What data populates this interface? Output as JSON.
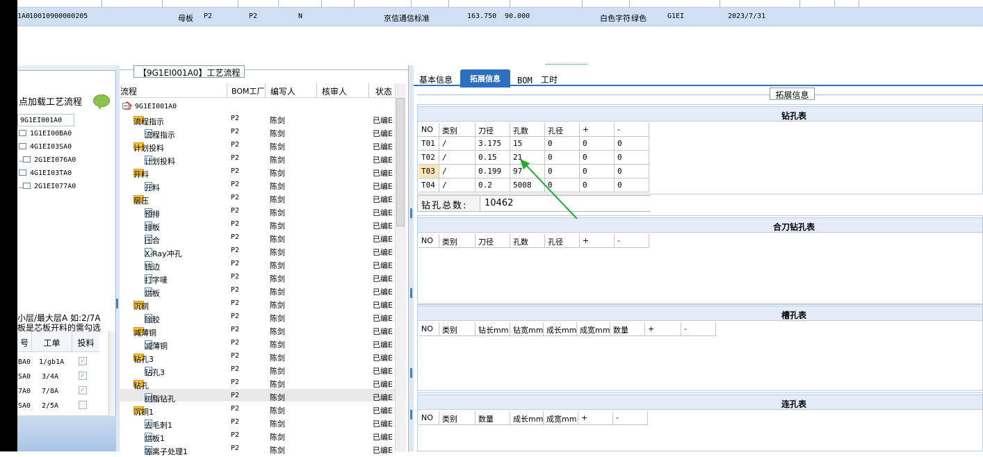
{
  "top_row": {
    "cells": [
      "1A0",
      "10010900000205",
      "母板",
      "P2",
      "P2",
      "N",
      "京信通信标准",
      "163.750",
      "90.000",
      "白色字符",
      "绿色",
      "G1EI",
      "2023/7/31"
    ]
  },
  "left_panel": {
    "load_label": "点加载工艺流程",
    "tree_root": "9G1EI001A0",
    "tree_items": [
      "1G1EI00BA0",
      "4G1EI03SA0",
      "2G1EI076A0",
      "4G1EI03TA0",
      "2G1EI077A0"
    ],
    "hint_line1": "小层/最大层A 如:2/7A",
    "hint_line2": "板是芯板开料的需勾选",
    "wo_headers": [
      "号",
      "工单",
      "投料"
    ],
    "wo_rows": [
      {
        "id": "BA0",
        "order": "1/gb1A",
        "checked": true
      },
      {
        "id": "SA0",
        "order": "3/4A",
        "checked": true
      },
      {
        "id": "7A0",
        "order": "7/8A",
        "checked": true
      },
      {
        "id": "SA0",
        "order": "2/5A",
        "checked": false
      }
    ]
  },
  "process_panel": {
    "title": "【9G1EI001A0】工艺流程",
    "headers": [
      "流程",
      "BOM工厂",
      "编写人",
      "核审人",
      "状态"
    ],
    "root": "9G1EI001A0",
    "rows": [
      {
        "name": "流程指示",
        "kind": "folder",
        "factory": "P2",
        "author": "陈剑",
        "status": "已编E"
      },
      {
        "name": "流程指示",
        "kind": "doc",
        "factory": "P2",
        "author": "陈剑",
        "status": "已编E"
      },
      {
        "name": "计划投料",
        "kind": "folder",
        "factory": "P2",
        "author": "陈剑",
        "status": "已编E"
      },
      {
        "name": "计划投料",
        "kind": "doc",
        "factory": "P2",
        "author": "陈剑",
        "status": "已编E"
      },
      {
        "name": "开料",
        "kind": "folder",
        "factory": "P2",
        "author": "陈剑",
        "status": "已编E"
      },
      {
        "name": "开料",
        "kind": "doc",
        "factory": "P2",
        "author": "陈剑",
        "status": "已编E"
      },
      {
        "name": "层压",
        "kind": "folder",
        "factory": "P2",
        "author": "陈剑",
        "status": "已编E"
      },
      {
        "name": "预排",
        "kind": "doc",
        "factory": "P2",
        "author": "陈剑",
        "status": "已编E"
      },
      {
        "name": "排板",
        "kind": "doc",
        "factory": "P2",
        "author": "陈剑",
        "status": "已编E"
      },
      {
        "name": "压合",
        "kind": "doc",
        "factory": "P2",
        "author": "陈剑",
        "status": "已编E"
      },
      {
        "name": "X-Ray冲孔",
        "kind": "doc",
        "factory": "P2",
        "author": "陈剑",
        "status": "已编E"
      },
      {
        "name": "铣边",
        "kind": "doc",
        "factory": "P2",
        "author": "陈剑",
        "status": "已编E"
      },
      {
        "name": "打字唛",
        "kind": "doc",
        "factory": "P2",
        "author": "陈剑",
        "status": "已编E"
      },
      {
        "name": "烘板",
        "kind": "doc",
        "factory": "P2",
        "author": "陈剑",
        "status": "已编E"
      },
      {
        "name": "沉铜",
        "kind": "folder",
        "factory": "P2",
        "author": "陈剑",
        "status": "已编E"
      },
      {
        "name": "除胶",
        "kind": "doc",
        "factory": "P2",
        "author": "陈剑",
        "status": "已编E"
      },
      {
        "name": "减薄铜",
        "kind": "folder",
        "factory": "P2",
        "author": "陈剑",
        "status": "已编E"
      },
      {
        "name": "减薄铜",
        "kind": "doc",
        "factory": "P2",
        "author": "陈剑",
        "status": "已编E"
      },
      {
        "name": "钻孔3",
        "kind": "folder",
        "factory": "P2",
        "author": "陈剑",
        "status": "已编E"
      },
      {
        "name": "钻孔3",
        "kind": "doc",
        "factory": "P2",
        "author": "陈剑",
        "status": "已编E"
      },
      {
        "name": "钻孔",
        "kind": "folder",
        "factory": "P2",
        "author": "陈剑",
        "status": "已编E"
      },
      {
        "name": "树脂钻孔",
        "kind": "doc",
        "factory": "P2",
        "author": "陈剑",
        "status": "已编E"
      },
      {
        "name": "沉铜1",
        "kind": "folder",
        "factory": "P2",
        "author": "陈剑",
        "status": "已编E"
      },
      {
        "name": "去毛刺1",
        "kind": "doc",
        "factory": "P2",
        "author": "陈剑",
        "status": "已编E"
      },
      {
        "name": "烘板1",
        "kind": "doc",
        "factory": "P2",
        "author": "陈剑",
        "status": "已编E"
      },
      {
        "name": "等离子处理1",
        "kind": "doc",
        "factory": "P2",
        "author": "陈剑",
        "status": "已编E"
      }
    ]
  },
  "right_panel": {
    "tabs": [
      "基本信息",
      "拓展信息",
      "BOM",
      "工时"
    ],
    "active_tab": "拓展信息",
    "group_title": "拓展信息",
    "drill_table": {
      "title": "钻孔表",
      "headers": [
        "NO",
        "类别",
        "刀径",
        "孔数",
        "孔径",
        "+",
        "-"
      ],
      "rows": [
        [
          "T01",
          "/",
          "3.175",
          "15",
          "0",
          "0",
          "0"
        ],
        [
          "T02",
          "/",
          "0.15",
          "21",
          "0",
          "0",
          "0"
        ],
        [
          "T03",
          "/",
          "0.199",
          "97",
          "0",
          "0",
          "0"
        ],
        [
          "T04",
          "/",
          "0.2",
          "5008",
          "0",
          "0",
          "0"
        ]
      ],
      "total_label": "钻孔总数:",
      "total_value": "10462"
    },
    "combined_table": {
      "title": "合刀钻孔表",
      "headers": [
        "NO",
        "类别",
        "刀径",
        "孔数",
        "孔径",
        "+",
        "-"
      ]
    },
    "slot_table": {
      "title": "槽孔表",
      "headers": [
        "NO",
        "类别",
        "钻长mm",
        "钻宽mm",
        "成长mm",
        "成宽mm",
        "数量",
        "+",
        "-"
      ]
    },
    "link_table": {
      "title": "连孔表",
      "headers": [
        "NO",
        "类别",
        "数量",
        "成长mm",
        "成宽mm",
        "+",
        "-"
      ]
    }
  },
  "colors": {
    "accent": "#2c6fbf",
    "row_blue": "#cfe0f2",
    "arrow_green": "#22aa33",
    "no_cell": "#fde5b7"
  }
}
